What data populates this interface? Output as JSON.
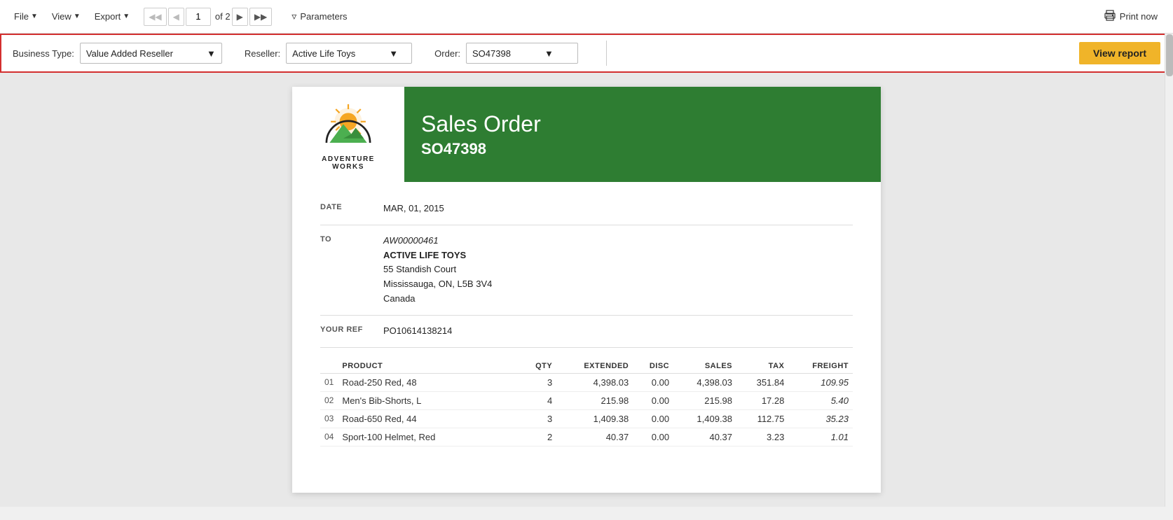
{
  "toolbar": {
    "file_label": "File",
    "view_label": "View",
    "export_label": "Export",
    "page_current": "1",
    "page_of": "of 2",
    "parameters_label": "Parameters",
    "print_label": "Print now"
  },
  "params_bar": {
    "business_type_label": "Business Type:",
    "business_type_value": "Value Added Reseller",
    "reseller_label": "Reseller:",
    "reseller_value": "Active Life Toys",
    "order_label": "Order:",
    "order_value": "SO47398",
    "view_report_label": "View report"
  },
  "report": {
    "logo_company": "ADVENTURE\nWORKS",
    "header_title": "Sales Order",
    "header_order": "SO47398",
    "date_label": "DATE",
    "date_value": "MAR, 01, 2015",
    "to_label": "TO",
    "to_account": "AW00000461",
    "to_name": "ACTIVE LIFE TOYS",
    "to_address1": "55 Standish Court",
    "to_address2": "Mississauga, ON, L5B 3V4",
    "to_address3": "Canada",
    "ref_label": "YOUR REF",
    "ref_value": "PO10614138214",
    "table_headers": {
      "product": "PRODUCT",
      "qty": "QTY",
      "extended": "EXTENDED",
      "disc": "DISC",
      "sales": "SALES",
      "tax": "TAX",
      "freight": "FREIGHT"
    },
    "rows": [
      {
        "num": "01",
        "product": "Road-250 Red, 48",
        "qty": "3",
        "extended": "4,398.03",
        "disc": "0.00",
        "sales": "4,398.03",
        "tax": "351.84",
        "freight": "109.95"
      },
      {
        "num": "02",
        "product": "Men's Bib-Shorts, L",
        "qty": "4",
        "extended": "215.98",
        "disc": "0.00",
        "sales": "215.98",
        "tax": "17.28",
        "freight": "5.40"
      },
      {
        "num": "03",
        "product": "Road-650 Red, 44",
        "qty": "3",
        "extended": "1,409.38",
        "disc": "0.00",
        "sales": "1,409.38",
        "tax": "112.75",
        "freight": "35.23"
      },
      {
        "num": "04",
        "product": "Sport-100 Helmet, Red",
        "qty": "2",
        "extended": "40.37",
        "disc": "0.00",
        "sales": "40.37",
        "tax": "3.23",
        "freight": "1.01"
      }
    ]
  }
}
